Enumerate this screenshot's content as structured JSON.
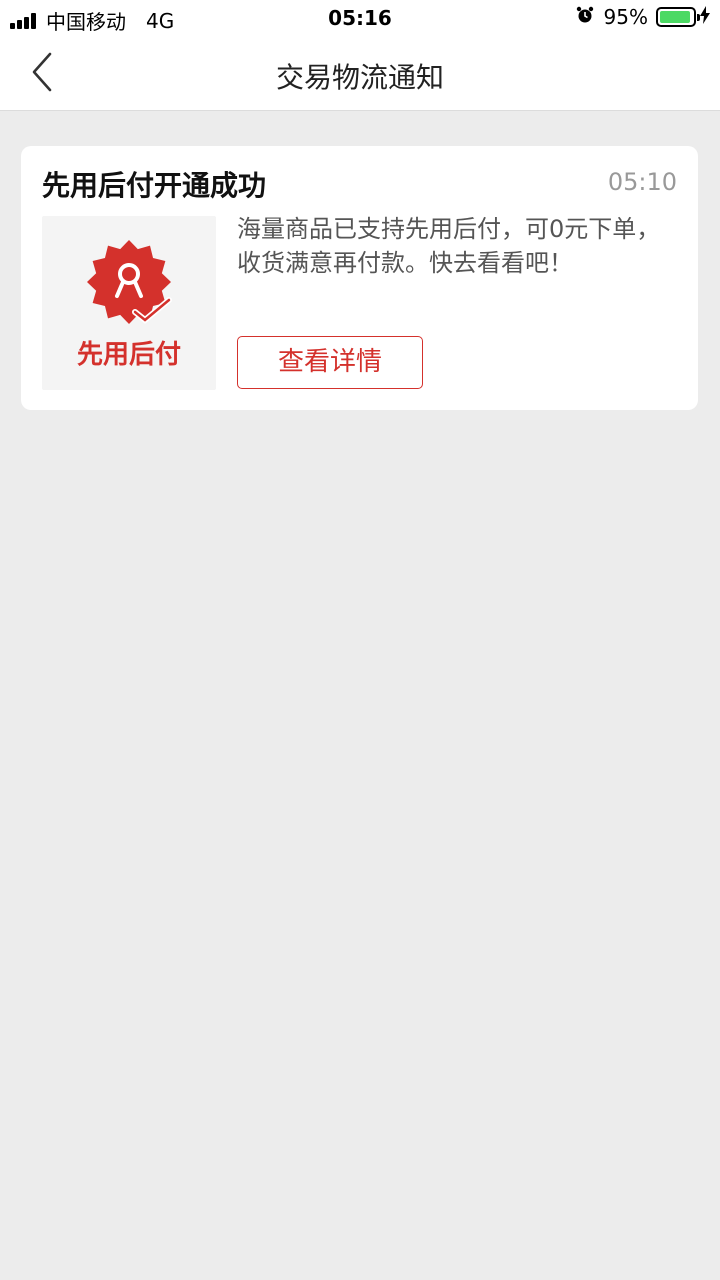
{
  "status_bar": {
    "carrier": "中国移动",
    "network": "4G",
    "time": "05:16",
    "battery_percent": "95%",
    "battery_level": 0.95,
    "battery_color": "#4cd964"
  },
  "nav": {
    "title": "交易物流通知",
    "back_icon": "chevron-left-icon"
  },
  "notification": {
    "title": "先用后付开通成功",
    "time": "05:10",
    "badge_label": "先用后付",
    "description": "海量商品已支持先用后付，可0元下单，收货满意再付款。快去看看吧！",
    "button_label": "查看详情",
    "accent_color": "#d4312c"
  }
}
